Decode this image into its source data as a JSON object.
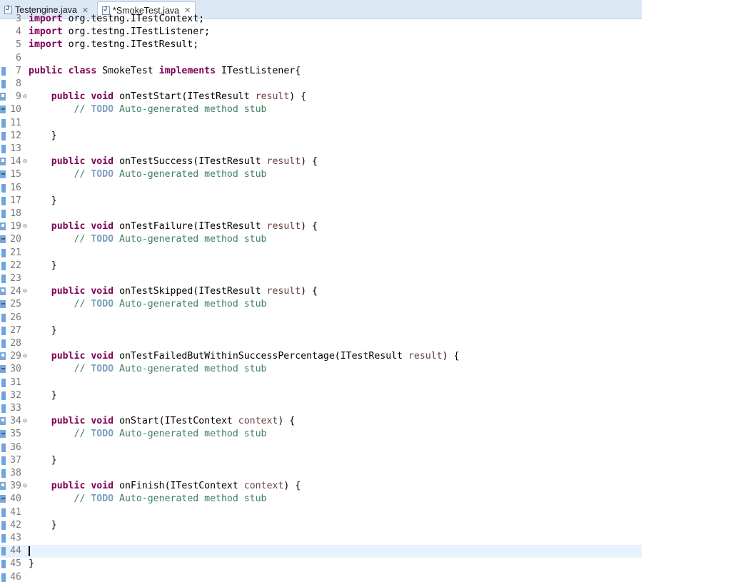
{
  "tabs": [
    {
      "label": "Testengine.java",
      "close": "✕",
      "active": false
    },
    {
      "label": "*SmokeTest.java",
      "close": "✕",
      "active": true
    }
  ],
  "editor": {
    "current_line": "44",
    "lines": [
      {
        "n": "3",
        "tokens": [
          {
            "t": "import",
            "c": "kw"
          },
          {
            "t": " org.testng.ITestContext;",
            "c": ""
          }
        ],
        "partial": true
      },
      {
        "n": "4",
        "tokens": [
          {
            "t": "import",
            "c": "kw"
          },
          {
            "t": " org.testng.ITestListener;",
            "c": ""
          }
        ]
      },
      {
        "n": "5",
        "tokens": [
          {
            "t": "import",
            "c": "kw"
          },
          {
            "t": " org.testng.ITestResult;",
            "c": ""
          }
        ]
      },
      {
        "n": "6",
        "tokens": []
      },
      {
        "n": "7",
        "tokens": [
          {
            "t": "public",
            "c": "kw"
          },
          {
            "t": " ",
            "c": ""
          },
          {
            "t": "class",
            "c": "kw"
          },
          {
            "t": " SmokeTest ",
            "c": ""
          },
          {
            "t": "implements",
            "c": "kw"
          },
          {
            "t": " ITestListener{",
            "c": ""
          }
        ]
      },
      {
        "n": "8",
        "tokens": []
      },
      {
        "n": "9",
        "fold": true,
        "icon": "override",
        "tokens": [
          {
            "t": "    ",
            "c": ""
          },
          {
            "t": "public",
            "c": "kw"
          },
          {
            "t": " ",
            "c": ""
          },
          {
            "t": "void",
            "c": "kw"
          },
          {
            "t": " onTestStart(ITestResult ",
            "c": ""
          },
          {
            "t": "result",
            "c": "param"
          },
          {
            "t": ") {",
            "c": ""
          }
        ]
      },
      {
        "n": "10",
        "icon": "task",
        "tokens": [
          {
            "t": "        // ",
            "c": "comment"
          },
          {
            "t": "TODO",
            "c": "todo"
          },
          {
            "t": " Auto-generated method stub",
            "c": "comment"
          }
        ]
      },
      {
        "n": "11",
        "tokens": []
      },
      {
        "n": "12",
        "tokens": [
          {
            "t": "    }",
            "c": ""
          }
        ]
      },
      {
        "n": "13",
        "tokens": []
      },
      {
        "n": "14",
        "fold": true,
        "icon": "override",
        "tokens": [
          {
            "t": "    ",
            "c": ""
          },
          {
            "t": "public",
            "c": "kw"
          },
          {
            "t": " ",
            "c": ""
          },
          {
            "t": "void",
            "c": "kw"
          },
          {
            "t": " onTestSuccess(ITestResult ",
            "c": ""
          },
          {
            "t": "result",
            "c": "param"
          },
          {
            "t": ") {",
            "c": ""
          }
        ]
      },
      {
        "n": "15",
        "icon": "task",
        "tokens": [
          {
            "t": "        // ",
            "c": "comment"
          },
          {
            "t": "TODO",
            "c": "todo"
          },
          {
            "t": " Auto-generated method stub",
            "c": "comment"
          }
        ]
      },
      {
        "n": "16",
        "tokens": []
      },
      {
        "n": "17",
        "tokens": [
          {
            "t": "    }",
            "c": ""
          }
        ]
      },
      {
        "n": "18",
        "tokens": []
      },
      {
        "n": "19",
        "fold": true,
        "icon": "override",
        "tokens": [
          {
            "t": "    ",
            "c": ""
          },
          {
            "t": "public",
            "c": "kw"
          },
          {
            "t": " ",
            "c": ""
          },
          {
            "t": "void",
            "c": "kw"
          },
          {
            "t": " onTestFailure(ITestResult ",
            "c": ""
          },
          {
            "t": "result",
            "c": "param"
          },
          {
            "t": ") {",
            "c": ""
          }
        ]
      },
      {
        "n": "20",
        "icon": "task",
        "tokens": [
          {
            "t": "        // ",
            "c": "comment"
          },
          {
            "t": "TODO",
            "c": "todo"
          },
          {
            "t": " Auto-generated method stub",
            "c": "comment"
          }
        ]
      },
      {
        "n": "21",
        "tokens": []
      },
      {
        "n": "22",
        "tokens": [
          {
            "t": "    }",
            "c": ""
          }
        ]
      },
      {
        "n": "23",
        "tokens": []
      },
      {
        "n": "24",
        "fold": true,
        "icon": "override",
        "tokens": [
          {
            "t": "    ",
            "c": ""
          },
          {
            "t": "public",
            "c": "kw"
          },
          {
            "t": " ",
            "c": ""
          },
          {
            "t": "void",
            "c": "kw"
          },
          {
            "t": " onTestSkipped(ITestResult ",
            "c": ""
          },
          {
            "t": "result",
            "c": "param"
          },
          {
            "t": ") {",
            "c": ""
          }
        ]
      },
      {
        "n": "25",
        "icon": "task",
        "tokens": [
          {
            "t": "        // ",
            "c": "comment"
          },
          {
            "t": "TODO",
            "c": "todo"
          },
          {
            "t": " Auto-generated method stub",
            "c": "comment"
          }
        ]
      },
      {
        "n": "26",
        "tokens": []
      },
      {
        "n": "27",
        "tokens": [
          {
            "t": "    }",
            "c": ""
          }
        ]
      },
      {
        "n": "28",
        "tokens": []
      },
      {
        "n": "29",
        "fold": true,
        "icon": "override",
        "tokens": [
          {
            "t": "    ",
            "c": ""
          },
          {
            "t": "public",
            "c": "kw"
          },
          {
            "t": " ",
            "c": ""
          },
          {
            "t": "void",
            "c": "kw"
          },
          {
            "t": " onTestFailedButWithinSuccessPercentage(ITestResult ",
            "c": ""
          },
          {
            "t": "result",
            "c": "param"
          },
          {
            "t": ") {",
            "c": ""
          }
        ]
      },
      {
        "n": "30",
        "icon": "task",
        "tokens": [
          {
            "t": "        // ",
            "c": "comment"
          },
          {
            "t": "TODO",
            "c": "todo"
          },
          {
            "t": " Auto-generated method stub",
            "c": "comment"
          }
        ]
      },
      {
        "n": "31",
        "tokens": []
      },
      {
        "n": "32",
        "tokens": [
          {
            "t": "    }",
            "c": ""
          }
        ]
      },
      {
        "n": "33",
        "tokens": []
      },
      {
        "n": "34",
        "fold": true,
        "icon": "override",
        "tokens": [
          {
            "t": "    ",
            "c": ""
          },
          {
            "t": "public",
            "c": "kw"
          },
          {
            "t": " ",
            "c": ""
          },
          {
            "t": "void",
            "c": "kw"
          },
          {
            "t": " onStart(ITestContext ",
            "c": ""
          },
          {
            "t": "context",
            "c": "param"
          },
          {
            "t": ") {",
            "c": ""
          }
        ]
      },
      {
        "n": "35",
        "icon": "task",
        "tokens": [
          {
            "t": "        // ",
            "c": "comment"
          },
          {
            "t": "TODO",
            "c": "todo"
          },
          {
            "t": " Auto-generated method stub",
            "c": "comment"
          }
        ]
      },
      {
        "n": "36",
        "tokens": []
      },
      {
        "n": "37",
        "tokens": [
          {
            "t": "    }",
            "c": ""
          }
        ]
      },
      {
        "n": "38",
        "tokens": []
      },
      {
        "n": "39",
        "fold": true,
        "icon": "override",
        "tokens": [
          {
            "t": "    ",
            "c": ""
          },
          {
            "t": "public",
            "c": "kw"
          },
          {
            "t": " ",
            "c": ""
          },
          {
            "t": "void",
            "c": "kw"
          },
          {
            "t": " onFinish(ITestContext ",
            "c": ""
          },
          {
            "t": "context",
            "c": "param"
          },
          {
            "t": ") {",
            "c": ""
          }
        ]
      },
      {
        "n": "40",
        "icon": "task",
        "tokens": [
          {
            "t": "        // ",
            "c": "comment"
          },
          {
            "t": "TODO",
            "c": "todo"
          },
          {
            "t": " Auto-generated method stub",
            "c": "comment"
          }
        ]
      },
      {
        "n": "41",
        "tokens": []
      },
      {
        "n": "42",
        "tokens": [
          {
            "t": "    }",
            "c": ""
          }
        ]
      },
      {
        "n": "43",
        "tokens": []
      },
      {
        "n": "44",
        "tokens": []
      },
      {
        "n": "45",
        "tokens": [
          {
            "t": "}",
            "c": ""
          }
        ]
      },
      {
        "n": "46",
        "tokens": []
      }
    ]
  }
}
